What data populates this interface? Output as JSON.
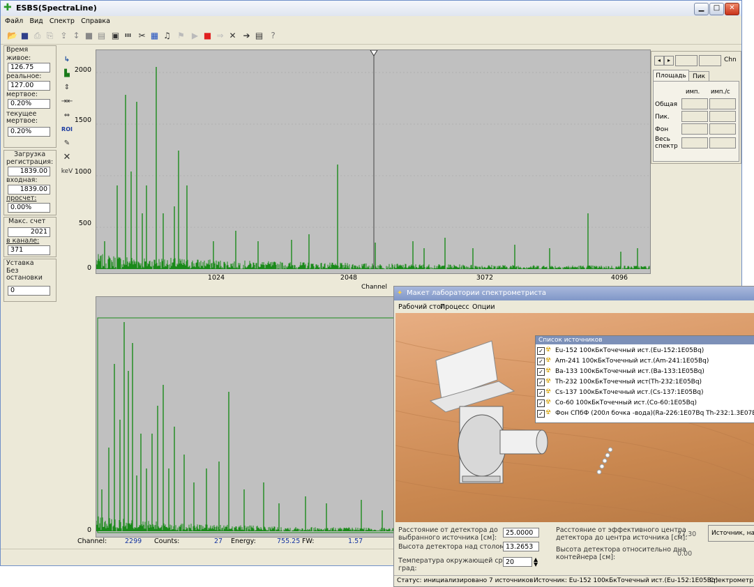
{
  "window": {
    "title": "ESBS(SpectraLine)"
  },
  "menu": [
    "Файл",
    "Вид",
    "Спектр",
    "Справка"
  ],
  "left_panel": {
    "time_group": "Время",
    "live_label": "живое:",
    "live_value": "126.75",
    "real_label": "реальное:",
    "real_value": "127.00",
    "dead_label": "мертвое:",
    "dead_value": "0.20%",
    "cur_dead_label_1": "текущее",
    "cur_dead_label_2": "мертвое:",
    "cur_dead_value": "0.20%",
    "load_group": "Загрузка",
    "reg_label": "регистрация:",
    "reg_value": "1839.00",
    "in_label": "входная:",
    "in_value": "1839.00",
    "miss_label": "просчет:",
    "miss_value": "0.00%",
    "max_group": "Макс. счет",
    "max_value": "2021",
    "chan_label": "в канале:",
    "chan_value": "371",
    "preset_group": "Уставка",
    "preset_line1": "Без",
    "preset_line2": "остановки",
    "preset_value": "0"
  },
  "vstrip": {
    "kev": "keV"
  },
  "upper_plot": {
    "yticks": [
      "2000",
      "1500",
      "1000",
      "500",
      "0"
    ],
    "xticks": [
      "1024",
      "2048",
      "3072",
      "4096"
    ],
    "xlabel": "Channel"
  },
  "right_panel": {
    "chn": "Chn",
    "tab_area": "Площадь",
    "tab_peak": "Пик",
    "col_imp": "имп.",
    "col_imps": "имп./с",
    "row_total": "Общая",
    "row_peak": "Пик.",
    "row_bg": "Фон",
    "row_all_1": "Весь",
    "row_all_2": "спектр"
  },
  "lower_plot": {
    "ytick": "0"
  },
  "cursor": {
    "channel_label": "Channel:",
    "channel_value": "2299",
    "counts_label": "Counts:",
    "counts_value": "27",
    "energy_label": "Energy:",
    "energy_value": "755.25",
    "fw_label": "FW:",
    "fw_value": "1.57"
  },
  "lab": {
    "title": "Макет лаборатории спектрометриста",
    "menu": [
      "Рабочий стол",
      "Процесс",
      "Опции"
    ],
    "sources_title": "Список источников",
    "sources": [
      "Eu-152 100кБкТочечный ист.(Eu-152:1E05Bq)",
      "Am-241 100кБкТочечный ист.(Am-241:1E05Bq)",
      "Ba-133 100кБкТочечный ист.(Ba-133:1E05Bq)",
      "Th-232 100кБкТочечный ист(Th-232:1E05Bq)",
      "Cs-137 100кБкТочечный ист.(Cs-137:1E05Bq)",
      "Co-60 100кБкТочечный ист.(Co-60:1E05Bq)",
      "Фон СПбФ (200л бочка -вода)(Ra-226:1E07Bq Th-232:1.3E07B"
    ],
    "dist_label_1": "Расстояние от детектора до",
    "dist_label_2": "выбранного источника [см]:",
    "dist_value": "25.0000",
    "height_label": "Высота детектора над столом [см]:",
    "height_value": "13.2653",
    "temp_label_1": "Температура окружающей среды,",
    "temp_label_2": "град:",
    "temp_value": "20",
    "eff_label_1": "Расстояние от эффективного центра",
    "eff_label_2": "детектора до центра источника [см]:",
    "eff_value": "27.30",
    "cont_label_1": "Высота детектора относительно дна",
    "cont_label_2": "контейнера [см]:",
    "cont_value": "0.00",
    "src_btn": "Источник, напр",
    "status_text": "Статус: инициализировано 7 источников",
    "status_source": "Источник: Eu-152 100кБкТочечный ист.(Eu-152:1E05Bq)",
    "status_spec": "Спектрометр:"
  }
}
